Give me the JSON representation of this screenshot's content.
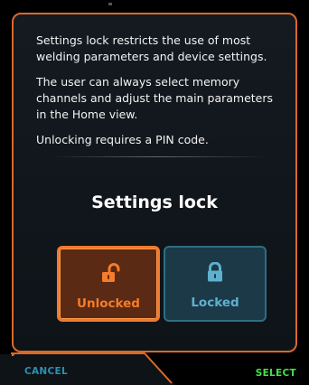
{
  "info": {
    "paragraph1": "Settings lock restricts the use of most welding parameters and device settings.",
    "paragraph2": "The user can always select memory channels and adjust the main parameters in the Home view.",
    "paragraph3": "Unlocking requires a PIN code."
  },
  "title": "Settings lock",
  "options": {
    "unlocked": {
      "label": "Unlocked",
      "icon": "unlocked-padlock-icon",
      "selected": true
    },
    "locked": {
      "label": "Locked",
      "icon": "locked-padlock-icon",
      "selected": false
    }
  },
  "footer": {
    "cancel_label": "CANCEL",
    "select_label": "SELECT"
  },
  "colors": {
    "accent": "#ef7a2e",
    "locked_accent": "#5fb0cf",
    "cancel": "#2f8fb0",
    "select": "#46e04a"
  }
}
